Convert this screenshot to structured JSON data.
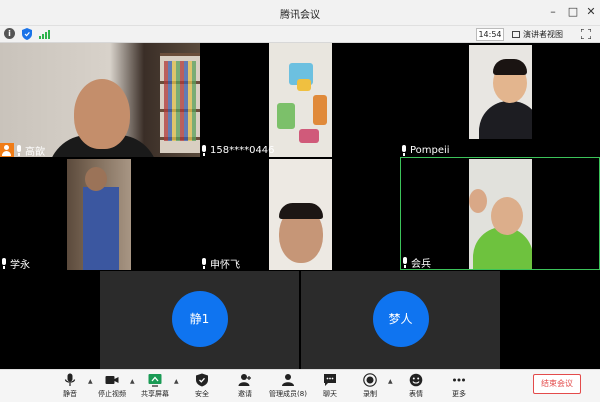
{
  "window": {
    "title": "腾讯会议",
    "controls": [
      "minimize",
      "maximize",
      "close"
    ]
  },
  "infobar": {
    "icons": [
      "info-icon",
      "shield-icon",
      "signal-icon"
    ],
    "time": "14:54",
    "view_label": "演讲者视图"
  },
  "participants": [
    {
      "name": "高歆",
      "host": true,
      "type": "video"
    },
    {
      "name": "158****0446",
      "host": false,
      "type": "video"
    },
    {
      "name": "Pompeii",
      "host": false,
      "type": "video"
    },
    {
      "name": "学永",
      "host": false,
      "type": "video"
    },
    {
      "name": "申怀飞",
      "host": false,
      "type": "video"
    },
    {
      "name": "会兵",
      "host": false,
      "type": "video",
      "speaking": true
    },
    {
      "name": "静1",
      "host": false,
      "type": "avatar"
    },
    {
      "name": "梦人",
      "host": false,
      "type": "avatar"
    }
  ],
  "toolbar": {
    "mute": "静音",
    "stop_video": "停止视频",
    "share_screen": "共享屏幕",
    "security": "安全",
    "invite": "邀请",
    "manage_members": "管理成员(8)",
    "chat": "聊天",
    "record": "录制",
    "reactions": "表情",
    "more": "更多",
    "end_meeting": "结束会议"
  },
  "colors": {
    "avatar_blue": "#0f74f0",
    "speaking_border": "#3cc35a",
    "end_red": "#e34b4b",
    "host_badge": "#f07c16"
  }
}
